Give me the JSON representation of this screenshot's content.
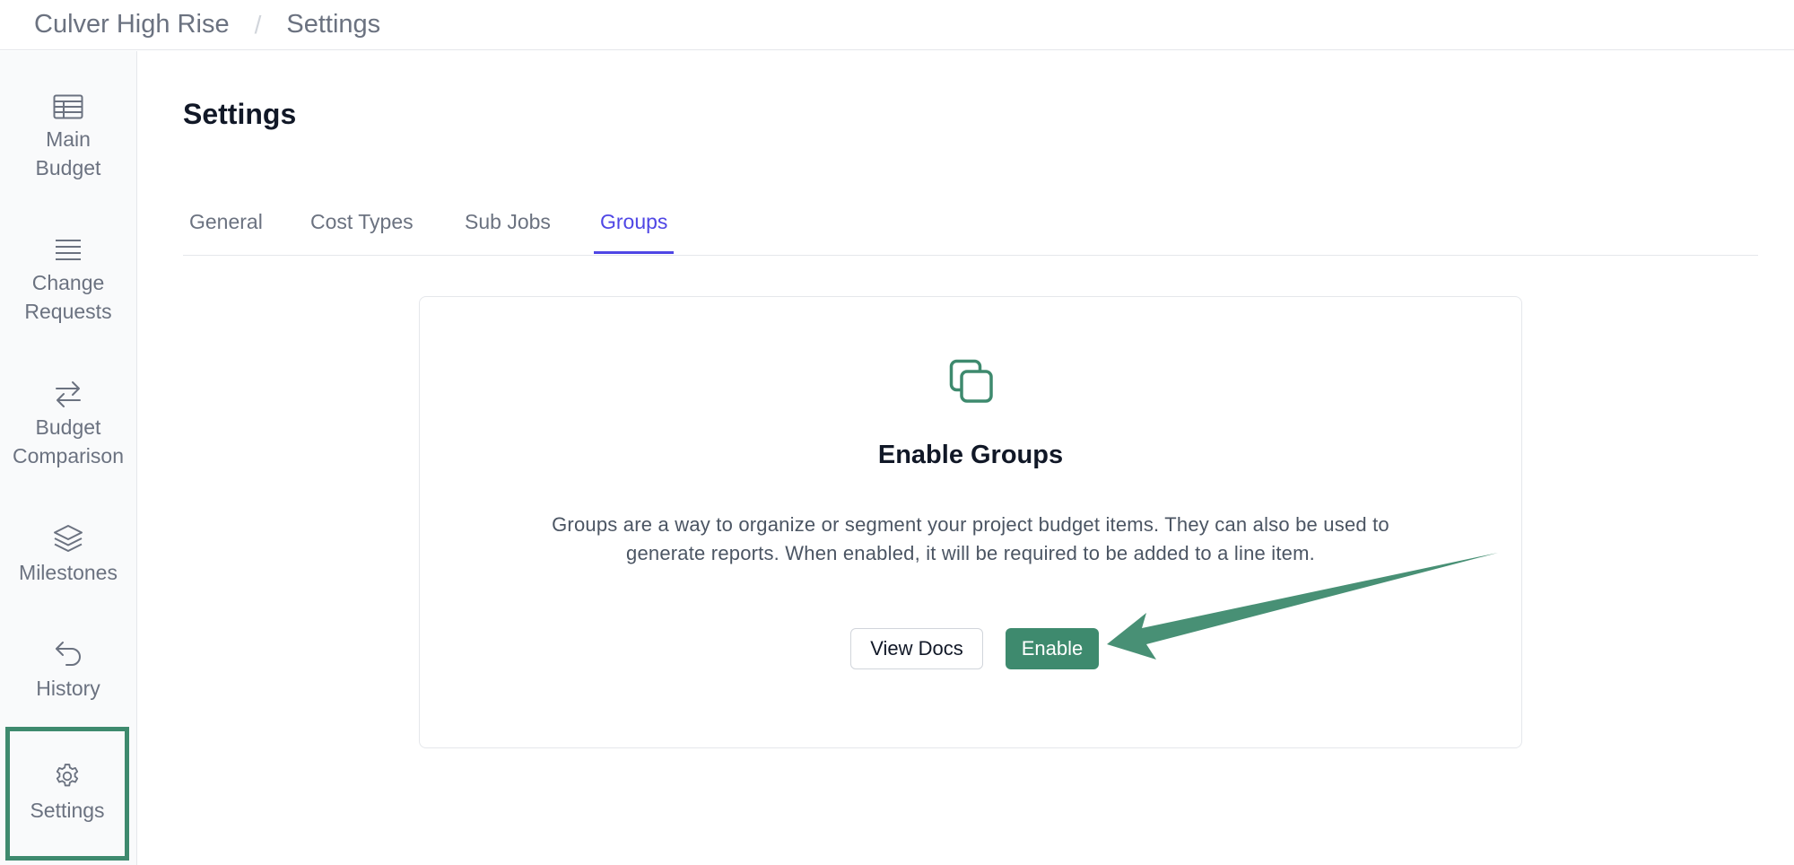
{
  "breadcrumb": {
    "project": "Culver High Rise",
    "separator": "/",
    "page": "Settings"
  },
  "sidebar": {
    "items": [
      {
        "label_line1": "Main",
        "label_line2": "Budget",
        "icon": "table-icon"
      },
      {
        "label_line1": "Change",
        "label_line2": "Requests",
        "icon": "list-icon"
      },
      {
        "label_line1": "Budget",
        "label_line2": "Comparison",
        "icon": "arrows-swap-icon"
      },
      {
        "label_line1": "Milestones",
        "label_line2": "",
        "icon": "layers-icon"
      },
      {
        "label_line1": "History",
        "label_line2": "",
        "icon": "undo-arrow-icon"
      },
      {
        "label_line1": "Settings",
        "label_line2": "",
        "icon": "gear-icon",
        "active": true
      }
    ]
  },
  "main": {
    "title": "Settings",
    "tabs": [
      {
        "label": "General"
      },
      {
        "label": "Cost Types"
      },
      {
        "label": "Sub Jobs"
      },
      {
        "label": "Groups",
        "active": true
      }
    ]
  },
  "card": {
    "icon": "copy-squares-icon",
    "title": "Enable Groups",
    "description_line1": "Groups are a way to organize or segment your project budget items. They can also be used to",
    "description_line2": "generate reports. When enabled, it will be required to be added to a line item.",
    "view_docs_label": "View Docs",
    "enable_label": "Enable"
  },
  "colors": {
    "accent_green": "#3e8a6e",
    "tab_active": "#4f46e5",
    "text_muted": "#6b7280"
  }
}
